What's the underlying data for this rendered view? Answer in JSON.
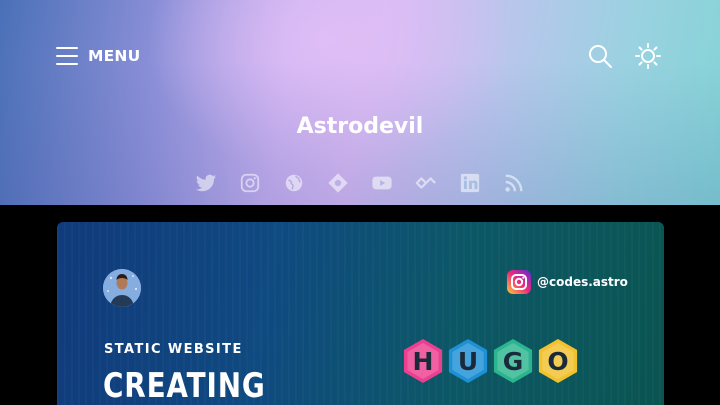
{
  "header": {
    "menu_label": "MENU",
    "site_title": "Astrodevil"
  },
  "social_links": [
    {
      "name": "twitter-icon"
    },
    {
      "name": "instagram-icon"
    },
    {
      "name": "website-icon"
    },
    {
      "name": "hashnode-icon"
    },
    {
      "name": "youtube-icon"
    },
    {
      "name": "devto-icon"
    },
    {
      "name": "linkedin-icon"
    },
    {
      "name": "rss-icon"
    }
  ],
  "featured_post": {
    "instagram_handle": "@codes.astro",
    "subtitle": "STATIC WEBSITE",
    "title": "CREATING",
    "logo_letters": [
      "H",
      "U",
      "G",
      "O"
    ],
    "logo_colors": [
      "#ec3f8f",
      "#1e90d6",
      "#2bb58e",
      "#f2c12e"
    ]
  },
  "colors": {
    "hero_start": "#4a70b7",
    "hero_mid": "#d8baf3",
    "hero_end": "#84d3d6",
    "card_start": "#103a7c",
    "card_end": "#0a5551"
  }
}
